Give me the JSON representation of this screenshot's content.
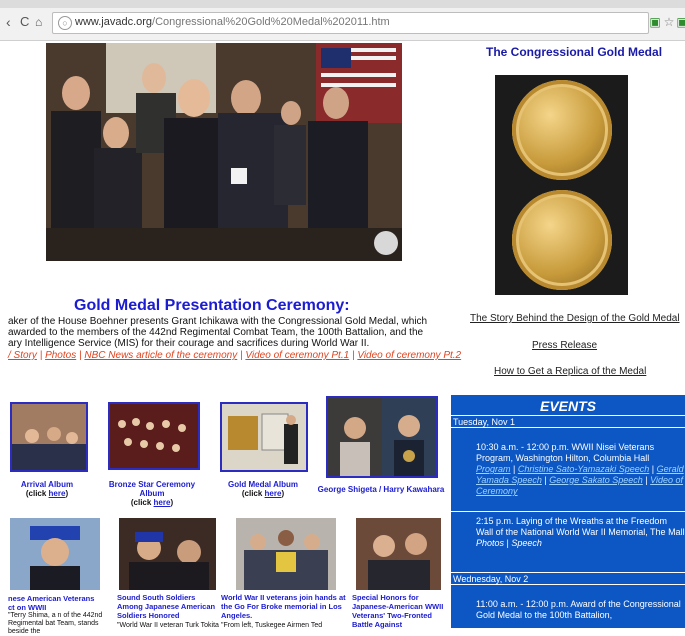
{
  "browser": {
    "url_domain": "www.javadc.org",
    "url_path": "/Congressional%20Gold%20Medal%202011.htm"
  },
  "sidebar": {
    "title": "The Congressional Gold Medal",
    "links": [
      "The Story Behind the Design of the Gold Medal",
      "Press Release",
      "How to Get a Replica of the Medal"
    ]
  },
  "ceremony": {
    "heading": "Gold Medal Presentation Ceremony:",
    "desc_lines": [
      "aker of the House Boehner presents Grant Ichikawa with the Congressional Gold Medal, which",
      "awarded to the members of the 442nd Regimental Combat Team, the 100th Battalion, and the",
      "ary Intelligence Service (MIS) for their courage and sacrifices during World War II."
    ],
    "links": [
      "/ Story",
      "Photos",
      "NBC News article of the ceremony",
      "Video of ceremony Pt.1",
      "Video of ceremony Pt.2"
    ]
  },
  "albums": [
    {
      "title": "Arrival Album",
      "click_prefix": "(click ",
      "click_link": "here",
      "click_suffix": ")"
    },
    {
      "title": "Bronze Star Ceremony Album",
      "click_prefix": "(click ",
      "click_link": "here",
      "click_suffix": ")"
    },
    {
      "title": "Gold Medal Album",
      "click_prefix": "(click ",
      "click_link": "here",
      "click_suffix": ")"
    },
    {
      "title": "George Shigeta / Harry Kawahara",
      "click_prefix": "",
      "click_link": "",
      "click_suffix": ""
    }
  ],
  "news": [
    {
      "title": "nese American Veterans ct on WWII",
      "body": "\"Terry Shima, a n of the 442nd Regimental bat Team, stands beside the"
    },
    {
      "title": "Sound South Soldiers Among Japanese American Soldiers Honored",
      "body": "\"World War II veteran Turk Tokita"
    },
    {
      "title": "World War II veterans join hands at the Go For Broke memorial in Los Angeles.",
      "body": "\"From left, Tuskegee Airmen Ted"
    },
    {
      "title": "Special Honors for Japanese-American WWII Veterans' Two-Fronted Battle Against",
      "body": ""
    }
  ],
  "events": {
    "heading": "EVENTS",
    "day1": "Tuesday, Nov 1",
    "e1_text": "10:30 a.m. - 12:00 p.m. WWII Nisei Veterans Program, Washington Hilton, Columbia Hall",
    "e1_links": [
      "Program",
      "Christine Sato-Yamazaki Speech",
      "Gerald Yamada Speech",
      "George Sakato Speech",
      "Video of Ceremony"
    ],
    "e2_text": "2:15 p.m. Laying of the Wreaths at the Freedom Wall of the National World War II Memorial, The Mall",
    "e2_links": [
      "Photos",
      "Speech"
    ],
    "day2": "Wednesday, Nov 2",
    "e3_text": "11:00 a.m. - 12:00 p.m. Award of the Congressional Gold Medal to the 100th Battalion,"
  },
  "colors": {
    "link_blue": "#1c1cd0",
    "link_orange": "#e0431f",
    "events_bg": "#0c57c4"
  }
}
